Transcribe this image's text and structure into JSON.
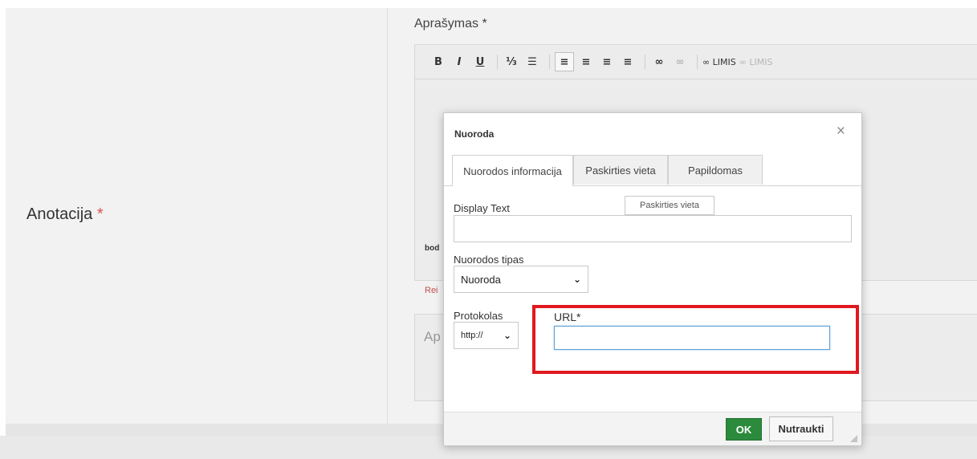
{
  "form": {
    "anotacija_label": "Anotacija",
    "required_mark": "*",
    "aprasymas_label": "Aprašymas *",
    "editor_path": "bod",
    "editor_hint": "Rei",
    "second_editor_placeholder": "Ap"
  },
  "toolbar": {
    "bold": "B",
    "italic": "I",
    "underline": "U",
    "ordered_list": "⅓",
    "bullet_list": "☰",
    "align_left": "≡",
    "align_center": "≡",
    "align_right": "≡",
    "justify": "≡",
    "link": "∞",
    "unlink": "∞",
    "limis_link": "∞ LIMIS",
    "limis_unlink": "∞ LIMIS"
  },
  "dialog": {
    "title": "Nuoroda",
    "close": "×",
    "tabs": [
      "Nuorodos informacija",
      "Paskirties vieta",
      "Papildomas"
    ],
    "tooltip": "Paskirties vieta",
    "display_text_label": "Display Text",
    "display_text_value": "",
    "link_type_label": "Nuorodos tipas",
    "link_type_value": "Nuoroda",
    "protocol_label": "Protokolas",
    "protocol_value": "http://",
    "url_label": "URL*",
    "url_value": "",
    "ok_label": "OK",
    "cancel_label": "Nutraukti"
  },
  "colors": {
    "ok_button": "#2c8a3d",
    "highlight": "#e0191f",
    "required": "#d9534f"
  }
}
